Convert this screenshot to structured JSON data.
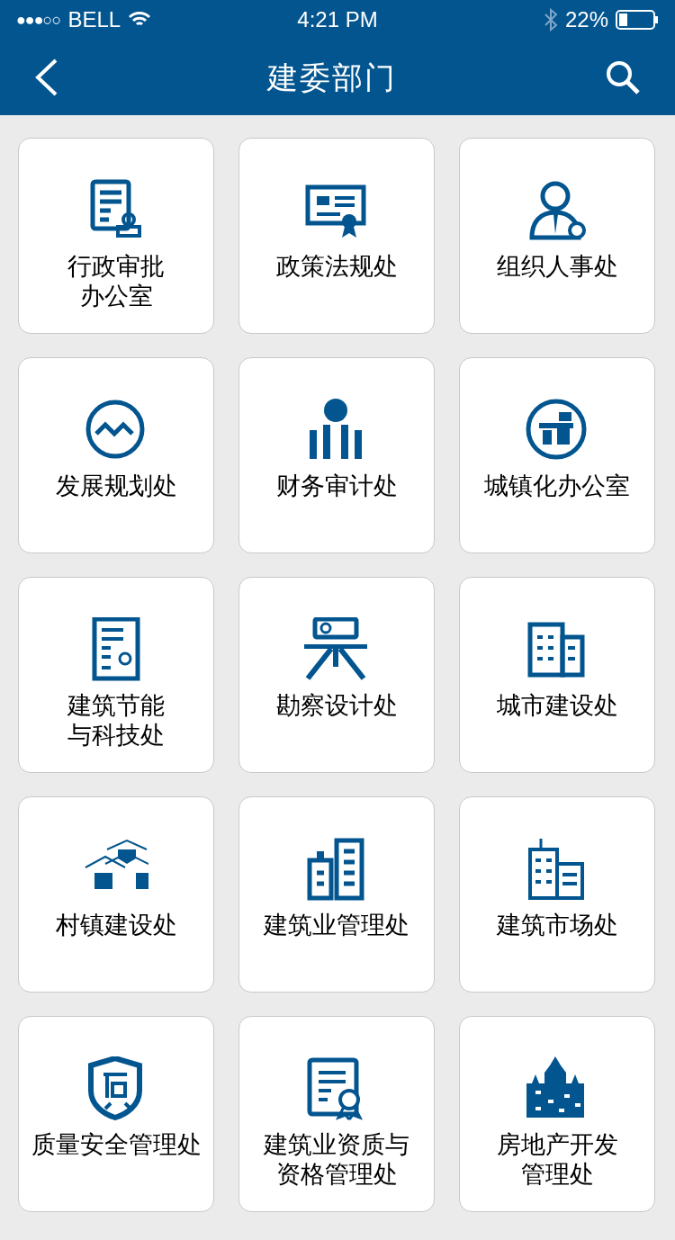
{
  "status_bar": {
    "signal": "●●●○○",
    "carrier": "BELL",
    "time": "4:21 PM",
    "battery": "22%"
  },
  "nav": {
    "title": "建委部门"
  },
  "departments": [
    {
      "name": [
        "行政审批",
        "办公室"
      ]
    },
    {
      "name": [
        "政策法规处"
      ]
    },
    {
      "name": [
        "组织人事处"
      ]
    },
    {
      "name": [
        "发展规划处"
      ]
    },
    {
      "name": [
        "财务审计处"
      ]
    },
    {
      "name": [
        "城镇化办公室"
      ]
    },
    {
      "name": [
        "建筑节能",
        "与科技处"
      ]
    },
    {
      "name": [
        "勘察设计处"
      ]
    },
    {
      "name": [
        "城市建设处"
      ]
    },
    {
      "name": [
        "村镇建设处"
      ]
    },
    {
      "name": [
        "建筑业管理处"
      ]
    },
    {
      "name": [
        "建筑市场处"
      ]
    },
    {
      "name": [
        "质量安全管理处"
      ]
    },
    {
      "name": [
        "建筑业资质与",
        "资格管理处"
      ]
    },
    {
      "name": [
        "房地产开发",
        "管理处"
      ]
    }
  ]
}
